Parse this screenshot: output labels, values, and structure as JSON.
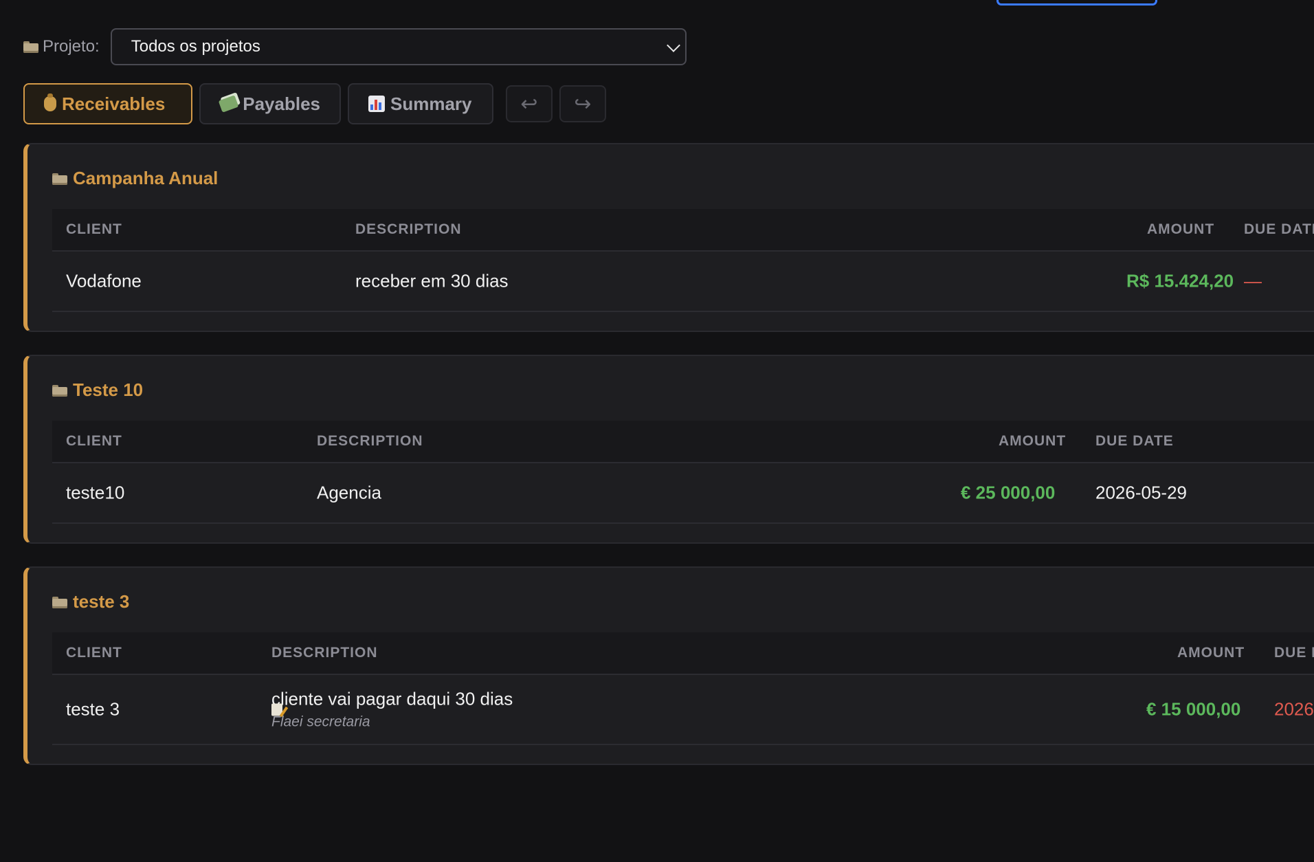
{
  "filter": {
    "label": "Projeto:",
    "selected": "Todos os projetos"
  },
  "tabs": [
    {
      "label": "Receivables",
      "icon": "money-bag-icon",
      "active": true
    },
    {
      "label": "Payables",
      "icon": "money-with-wings-icon",
      "active": false
    },
    {
      "label": "Summary",
      "icon": "bar-chart-icon",
      "active": false
    }
  ],
  "actions": {
    "undo_icon": "undo-icon",
    "redo_icon": "redo-icon"
  },
  "projects": [
    {
      "name": "Campanha Anual",
      "headers": {
        "client": "CLIENT",
        "description": "DESCRIPTION",
        "amount": "AMOUNT",
        "due_date": "DUE DATE"
      },
      "rows": [
        {
          "client": "Vodafone",
          "description": "receber em 30 dias",
          "amount": "R$ 15.424,20",
          "due_date": "—"
        }
      ]
    },
    {
      "name": "Teste 10",
      "headers": {
        "client": "CLIENT",
        "description": "DESCRIPTION",
        "amount": "AMOUNT",
        "due_date": "DUE DATE"
      },
      "rows": [
        {
          "client": "teste10",
          "description": "Agencia",
          "amount": "€ 25 000,00",
          "due_date": "2026-05-29"
        }
      ]
    },
    {
      "name": "teste 3",
      "headers": {
        "client": "CLIENT",
        "description": "DESCRIPTION",
        "amount": "AMOUNT",
        "due_date": "DUE D"
      },
      "rows": [
        {
          "client": "teste 3",
          "description": "cliente vai pagar daqui 30 dias",
          "note": "Flaei secretaria",
          "amount": "€ 15 000,00",
          "due_date": "2026"
        }
      ]
    }
  ],
  "colors": {
    "accent": "#d49a48",
    "amount": "#5cb85c",
    "overdue": "#e05a4f",
    "background": "#121214",
    "card": "#1e1e21"
  }
}
